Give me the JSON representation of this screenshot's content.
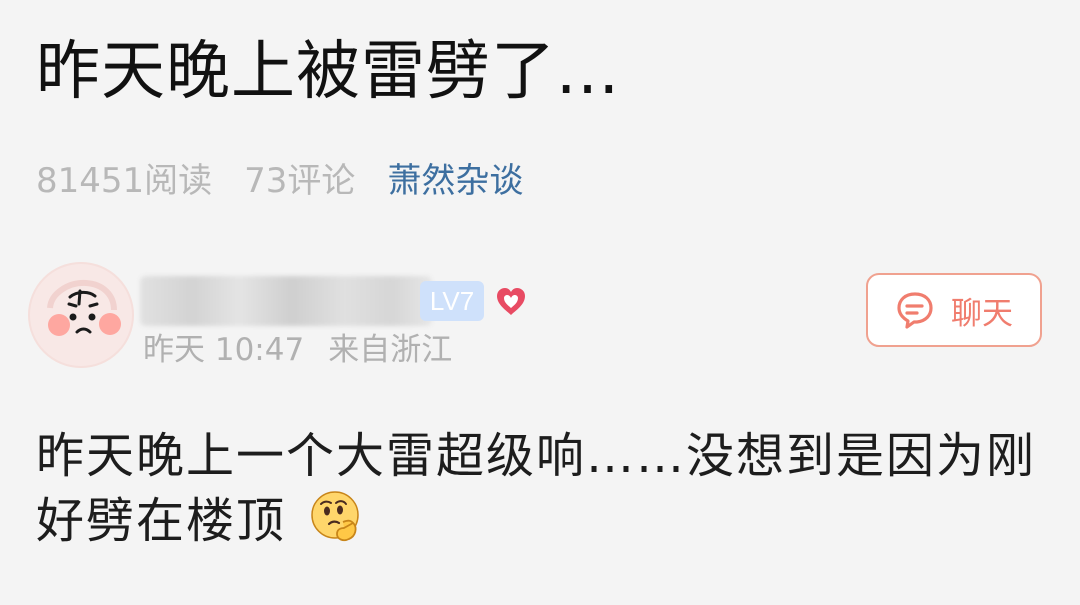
{
  "post": {
    "title": "昨天晚上被雷劈了...",
    "read_count": "81451阅读",
    "comment_count": "73评论",
    "channel": "萧然杂谈",
    "author": {
      "level": "LV7",
      "time": "昨天 10:47",
      "location": "来自浙江"
    },
    "chat_label": "聊天",
    "content": "昨天晚上一个大雷超级响……没想到是因为刚好劈在楼顶"
  },
  "icons": {
    "avatar": "avatar-illustration",
    "heart": "heart-icon",
    "chat": "chat-bubble-icon",
    "emoji": "thinking-emoji"
  },
  "colors": {
    "background": "#f4f4f4",
    "channel": "#3d6fa0",
    "muted": "#b8b8b8",
    "chat_accent": "#f07d6e",
    "level_badge": "#cfe1fb",
    "heart": "#e84b63"
  }
}
